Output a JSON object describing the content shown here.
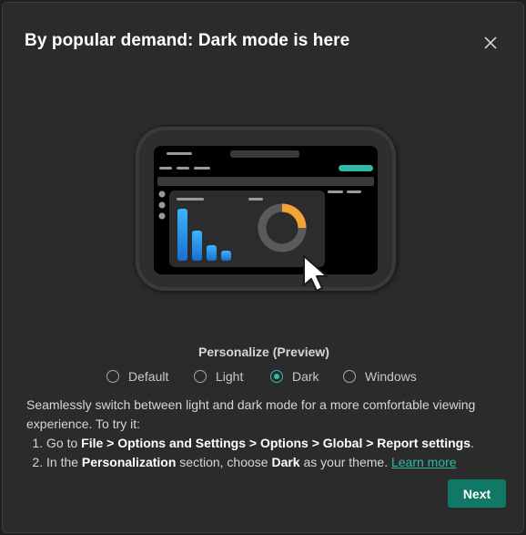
{
  "dialog": {
    "title": "By popular demand: Dark mode is here",
    "close_icon": "close-icon"
  },
  "illustration": {
    "icon": "dark-mode-preview-illustration",
    "cursor_icon": "pointer-cursor-icon"
  },
  "personalize": {
    "title": "Personalize (Preview)",
    "options": [
      {
        "label": "Default",
        "checked": false
      },
      {
        "label": "Light",
        "checked": false
      },
      {
        "label": "Dark",
        "checked": true
      },
      {
        "label": "Windows",
        "checked": false
      }
    ]
  },
  "description": {
    "intro": "Seamlessly switch between light and dark mode for a more comfortable viewing experience. To try it:",
    "step1": {
      "pre": "Go to ",
      "path": "File > Options and Settings > Options > Global > Report settings",
      "post": "."
    },
    "step2": {
      "pre": "In the ",
      "section": "Personalization",
      "mid": " section, choose ",
      "theme": "Dark",
      "post": " as your theme. ",
      "link": "Learn more"
    }
  },
  "footer": {
    "next_label": "Next"
  },
  "colors": {
    "accent": "#2ebba8",
    "button": "#117865",
    "background": "#2b2b2b"
  }
}
